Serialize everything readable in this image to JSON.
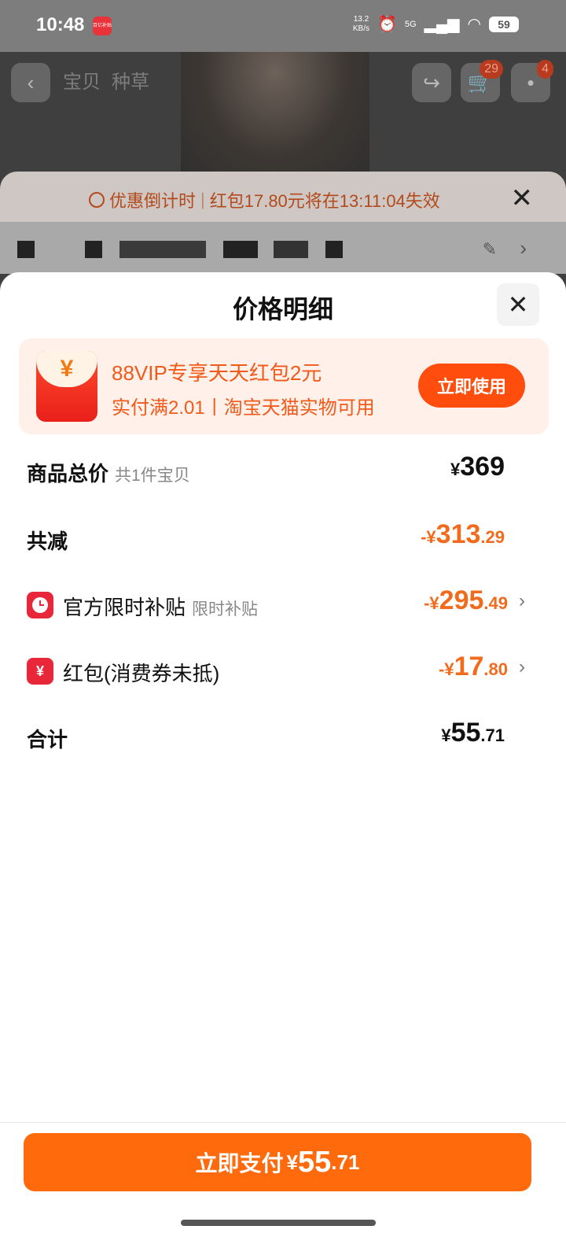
{
  "status_bar": {
    "time": "10:48",
    "net_speed_top": "13.2",
    "net_speed_bottom": "KB/s",
    "signal": "5G",
    "battery": "59",
    "app_badge": "百亿补贴"
  },
  "nav": {
    "tabs": [
      "宝贝",
      "种草"
    ],
    "cart_badge": "29",
    "msg_badge": "4",
    "icons": [
      "back-icon",
      "share-icon",
      "cart-icon",
      "more-icon"
    ]
  },
  "countdown": {
    "label": "优惠倒计时",
    "message": "红包17.80元将在13:11:04失效"
  },
  "sheet": {
    "title": "价格明细"
  },
  "promo": {
    "title": "88VIP专享天天红包2元",
    "subtitle": "实付满2.01丨淘宝天猫实物可用",
    "button": "立即使用",
    "envelope_symbol": "¥"
  },
  "rows": {
    "total": {
      "label": "商品总价",
      "sub": "共1件宝贝",
      "currency": "¥",
      "integer": "369",
      "decimal": ""
    },
    "reduced": {
      "label": "共减",
      "currency": "-¥",
      "integer": "313",
      "decimal": ".29"
    },
    "subsidy": {
      "label": "官方限时补贴",
      "sub": "限时补贴",
      "currency": "-¥",
      "integer": "295",
      "decimal": ".49"
    },
    "redpacket": {
      "label": "红包(消费券未抵)",
      "icon_symbol": "¥",
      "currency": "-¥",
      "integer": "17",
      "decimal": ".80"
    },
    "sum": {
      "label": "合计",
      "currency": "¥",
      "integer": "55",
      "decimal": ".71"
    }
  },
  "pay": {
    "label": "立即支付",
    "currency": "¥",
    "integer": "55",
    "decimal": ".71"
  },
  "colors": {
    "accent": "#ff6a0d",
    "discount": "#f26b1d",
    "promo_bg": "#fff1ea"
  }
}
